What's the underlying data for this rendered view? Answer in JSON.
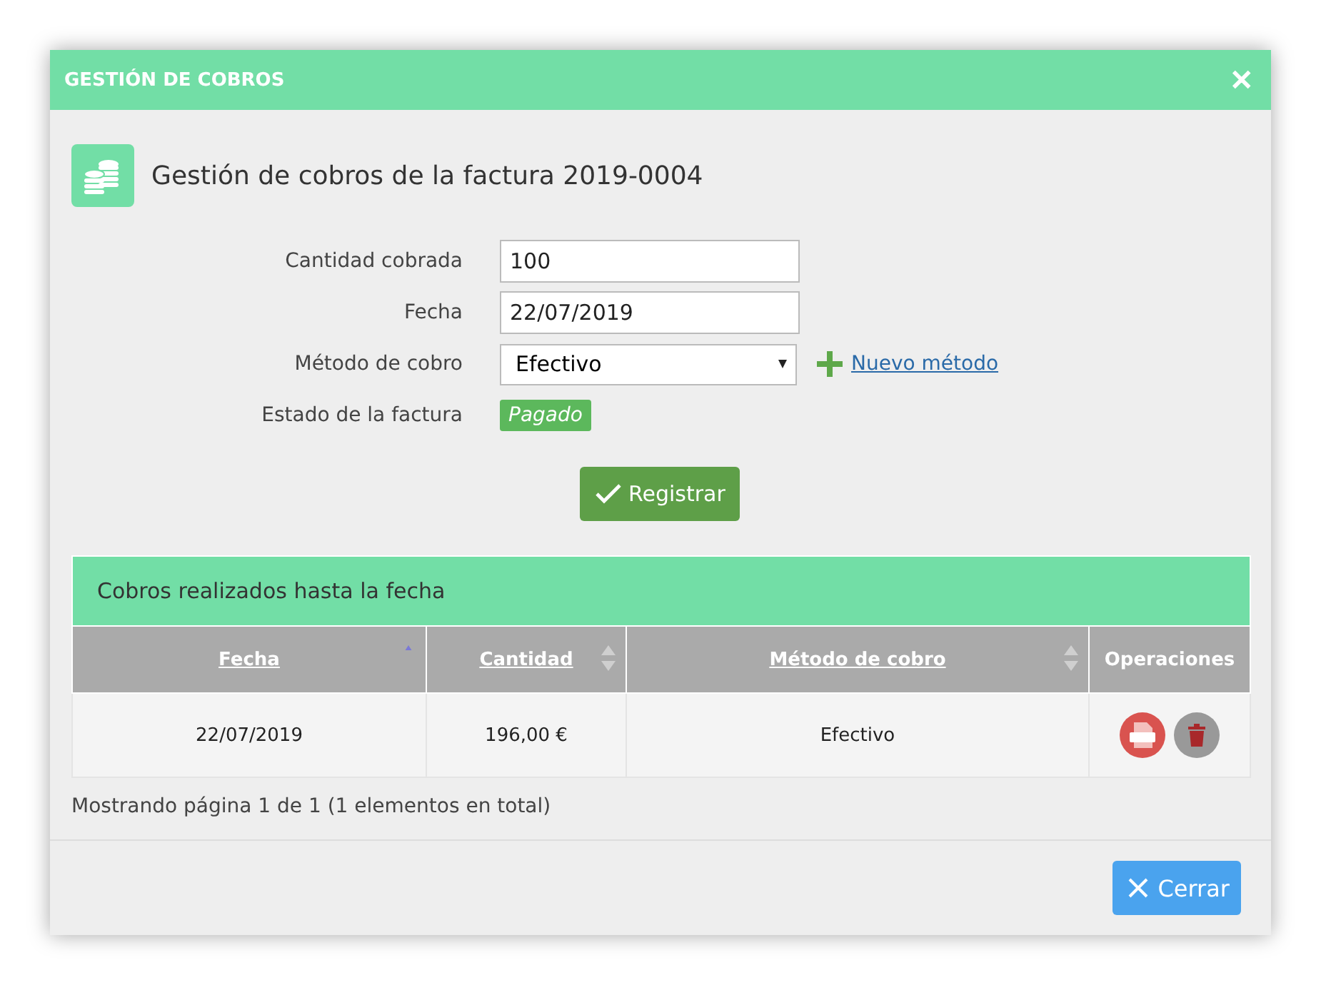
{
  "window": {
    "title": "GESTIÓN DE COBROS",
    "close": "✕"
  },
  "heading": "Gestión de cobros de la factura 2019-0004",
  "form": {
    "fields": [
      {
        "kind": "input",
        "label": "Cantidad cobrada",
        "value": "100"
      },
      {
        "kind": "input",
        "label": "Fecha",
        "value": "22/07/2019"
      },
      {
        "kind": "select",
        "label": "Método de cobro",
        "value": "Efectivo",
        "link": "Nuevo método"
      },
      {
        "kind": "badge",
        "label": "Estado de la factura",
        "value": "Pagado"
      }
    ],
    "submit": "Registrar"
  },
  "table": {
    "title": "Cobros realizados hasta la fecha",
    "columns": [
      {
        "label": "Fecha",
        "sortable": true,
        "sorted": true
      },
      {
        "label": "Cantidad",
        "sortable": true,
        "sorted": false
      },
      {
        "label": "Método de cobro",
        "sortable": true,
        "sorted": false
      },
      {
        "label": "Operaciones",
        "sortable": false
      }
    ],
    "rows": [
      {
        "cells": [
          "22/07/2019",
          "196,00 €",
          "Efectivo"
        ]
      }
    ],
    "footer": "Mostrando página 1 de 1 (1 elementos en total)"
  },
  "buttons": [
    {
      "label": "Cerrar"
    }
  ]
}
